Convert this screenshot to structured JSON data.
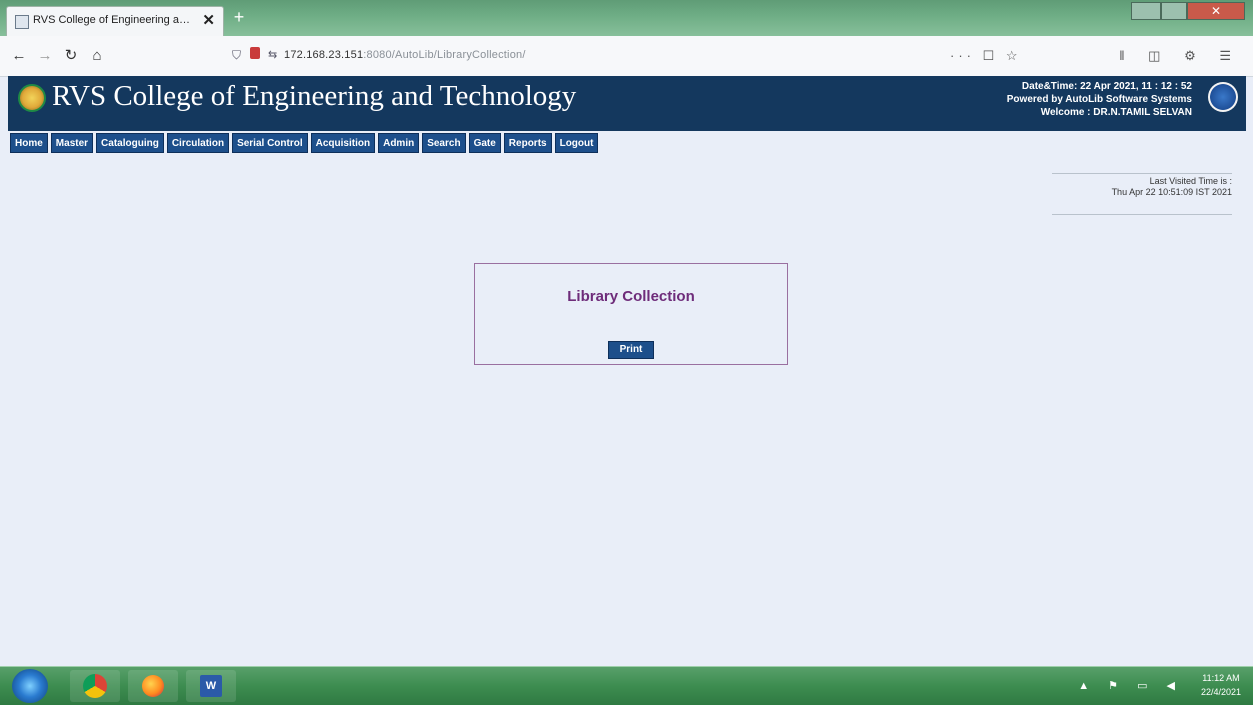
{
  "browser": {
    "tab_title": "RVS College of Engineering a…",
    "tab_close": "✕",
    "new_tab": "+",
    "url_host": "172.168.23.151",
    "url_rest": ":8080/AutoLib/LibraryCollection/",
    "page_actions": "··· ☐ ☆",
    "tools": "‖ ◫ ⚙ ☰"
  },
  "header": {
    "college_name": "RVS College of Engineering and Technology",
    "datetime": "Date&Time:  22 Apr 2021, 11 : 12 : 52",
    "powered_by": "Powered by AutoLib Software Systems",
    "welcome": "Welcome   :   DR.N.TAMIL SELVAN"
  },
  "menu": [
    "Home",
    "Master",
    "Cataloguing",
    "Circulation",
    "Serial Control",
    "Acquisition",
    "Admin",
    "Search",
    "Gate",
    "Reports",
    "Logout"
  ],
  "last_visited": {
    "label": "Last Visited Time is :",
    "value": "Thu Apr 22 10:51:09 IST 2021"
  },
  "main": {
    "title": "Library Collection",
    "print_label": "Print"
  },
  "taskbar": {
    "word_label": "W",
    "tray": "▲ ⚑ ▭ ◀",
    "time": "11:12 AM",
    "date": "22/4/2021"
  },
  "colors": {
    "header_bg": "#14385e",
    "menu_bg": "#1d4f8b",
    "title_color": "#6e2c7a",
    "page_bg": "#e9eef8"
  }
}
